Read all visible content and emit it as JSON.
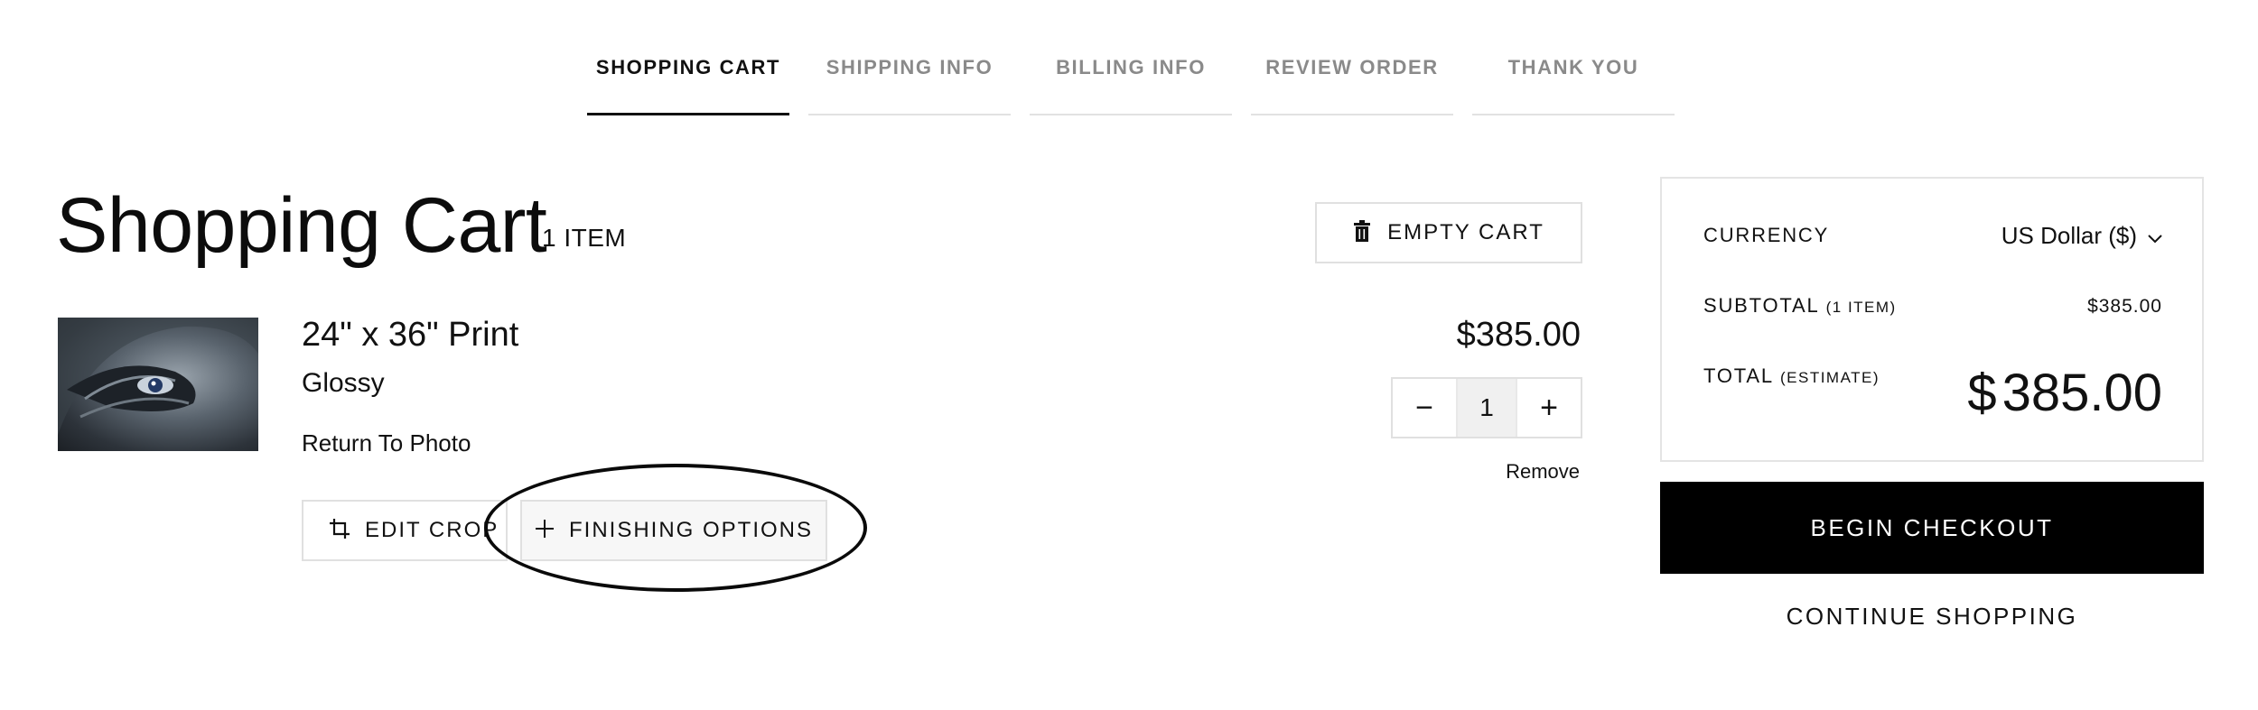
{
  "steps": [
    {
      "label": "SHOPPING CART",
      "active": true
    },
    {
      "label": "SHIPPING INFO",
      "active": false
    },
    {
      "label": "BILLING INFO",
      "active": false
    },
    {
      "label": "REVIEW ORDER",
      "active": false
    },
    {
      "label": "THANK YOU",
      "active": false
    }
  ],
  "cart": {
    "title": "Shopping Cart",
    "item_count": "1 ITEM",
    "empty_cart_label": "EMPTY CART"
  },
  "item": {
    "name": "24\" x 36\" Print",
    "finish": "Glossy",
    "return_link": "Return To Photo",
    "price": "$385.00",
    "quantity": "1",
    "decrement_label": "−",
    "increment_label": "+",
    "remove_label": "Remove",
    "edit_crop_label": "EDIT CROP",
    "finishing_label": "FINISHING OPTIONS",
    "thumbnail_icon": "photo-thumbnail"
  },
  "summary": {
    "currency_label": "CURRENCY",
    "currency_value": "US Dollar ($)",
    "subtotal_label": "SUBTOTAL",
    "subtotal_note": "(1 ITEM)",
    "subtotal_value": "$385.00",
    "total_label": "TOTAL",
    "total_note": "(ESTIMATE)",
    "total_currency": "$",
    "total_value": "385.00"
  },
  "actions": {
    "checkout_label": "BEGIN CHECKOUT",
    "continue_label": "CONTINUE SHOPPING"
  },
  "colors": {
    "accent": "#000000",
    "muted_step": "#8a8a8a",
    "border": "#e0e0e0"
  }
}
